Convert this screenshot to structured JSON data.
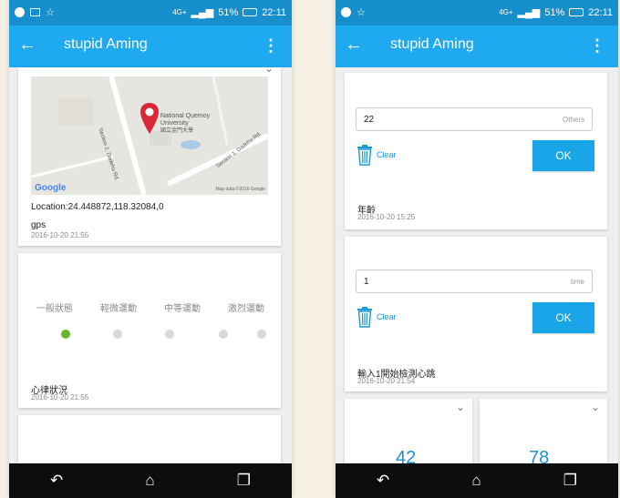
{
  "status_bar": {
    "battery": "51%",
    "time": "22:11",
    "network": "4G+"
  },
  "app_bar": {
    "title": "stupid Aming"
  },
  "left": {
    "location_card": {
      "map_label_en": "National Quemoy University",
      "map_label_zh": "國立金門大學",
      "street_1": "Section 2, Dadehu Rd.",
      "street_2": "Section 1, Dadehu Rd.",
      "google_logo": "Google",
      "map_attribution": "Map data ©2016 Google",
      "location": "Location:24.448872,118.32084,0",
      "type": "gps",
      "timestamp": "2016-10-20 21:55"
    },
    "heart_status_card": {
      "stages": [
        "一般狀態",
        "輕微運動",
        "中等運動",
        "激烈運動"
      ],
      "selected_index": 0,
      "title": "心律狀況",
      "timestamp": "2016-10-20 21:55"
    }
  },
  "right": {
    "age_card": {
      "input_value": "22",
      "input_placeholder": "Others",
      "clear_label": "Clear",
      "ok_label": "OK",
      "title": "年齡",
      "timestamp": "2016-10-20 15:25"
    },
    "heart_test_card": {
      "input_value": "1",
      "input_placeholder": "time",
      "clear_label": "Clear",
      "ok_label": "OK",
      "title": "輸入1開始檢測心跳",
      "timestamp": "2016-10-20 21:54"
    },
    "tiles": [
      {
        "value": "42"
      },
      {
        "value": "78"
      }
    ]
  },
  "colors": {
    "status_bar": "#168fcc",
    "app_bar": "#1ea9f0",
    "ok_button": "#19a6e8",
    "selected_dot": "#6ab42d",
    "map_pin": "#d9283a"
  }
}
